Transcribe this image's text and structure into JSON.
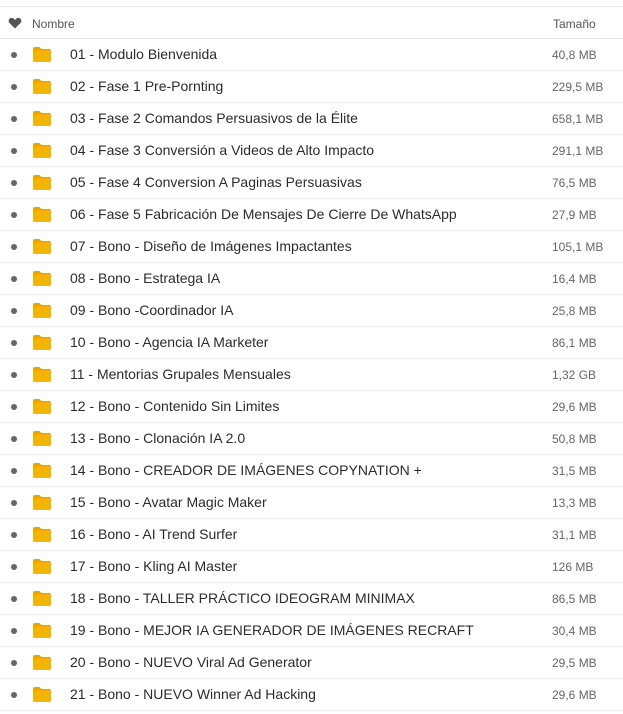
{
  "header": {
    "heart_icon": "heart-icon",
    "name_label": "Nombre",
    "size_label": "Tamaño"
  },
  "colors": {
    "folder": "#f5b400",
    "folder_tab": "#e6a700",
    "text": "#2b2b2b",
    "muted": "#666666",
    "divider": "#ededed"
  },
  "rows": [
    {
      "name": "01 - Modulo Bienvenida",
      "size": "40,8 MB"
    },
    {
      "name": "02 - Fase 1 Pre-Pornting",
      "size": "229,5 MB"
    },
    {
      "name": "03 - Fase 2 Comandos Persuasivos de la Élite",
      "size": "658,1 MB"
    },
    {
      "name": "04 - Fase 3 Conversión a Videos de Alto Impacto",
      "size": "291,1 MB"
    },
    {
      "name": "05 - Fase 4 Conversion A Paginas Persuasivas",
      "size": "76,5 MB"
    },
    {
      "name": "06 - Fase 5 Fabricación De Mensajes De Cierre De WhatsApp",
      "size": "27,9 MB"
    },
    {
      "name": "07 - Bono - Diseño de Imágenes Impactantes",
      "size": "105,1 MB"
    },
    {
      "name": "08 - Bono - Estratega IA",
      "size": "16,4 MB"
    },
    {
      "name": "09 - Bono -Coordinador IA",
      "size": "25,8 MB"
    },
    {
      "name": "10 - Bono - Agencia IA Marketer",
      "size": "86,1 MB"
    },
    {
      "name": "11 - Mentorias Grupales Mensuales",
      "size": "1,32 GB"
    },
    {
      "name": "12 - Bono - Contenido Sin Limites",
      "size": "29,6 MB"
    },
    {
      "name": "13 - Bono - Clonación IA 2.0",
      "size": "50,8 MB"
    },
    {
      "name": "14 - Bono - CREADOR DE IMÁGENES COPYNATION +",
      "size": "31,5 MB"
    },
    {
      "name": "15 - Bono - Avatar Magic Maker",
      "size": "13,3 MB"
    },
    {
      "name": "16 - Bono - AI Trend Surfer",
      "size": "31,1 MB"
    },
    {
      "name": "17 - Bono - Kling AI Master",
      "size": "126 MB"
    },
    {
      "name": "18 - Bono - TALLER PRÁCTICO IDEOGRAM MINIMAX",
      "size": "86,5 MB"
    },
    {
      "name": "19 - Bono - MEJOR IA GENERADOR DE IMÁGENES RECRAFT",
      "size": "30,4 MB"
    },
    {
      "name": "20 - Bono - NUEVO Viral Ad Generator",
      "size": "29,5 MB"
    },
    {
      "name": "21 - Bono - NUEVO Winner Ad Hacking",
      "size": "29,6 MB"
    }
  ]
}
